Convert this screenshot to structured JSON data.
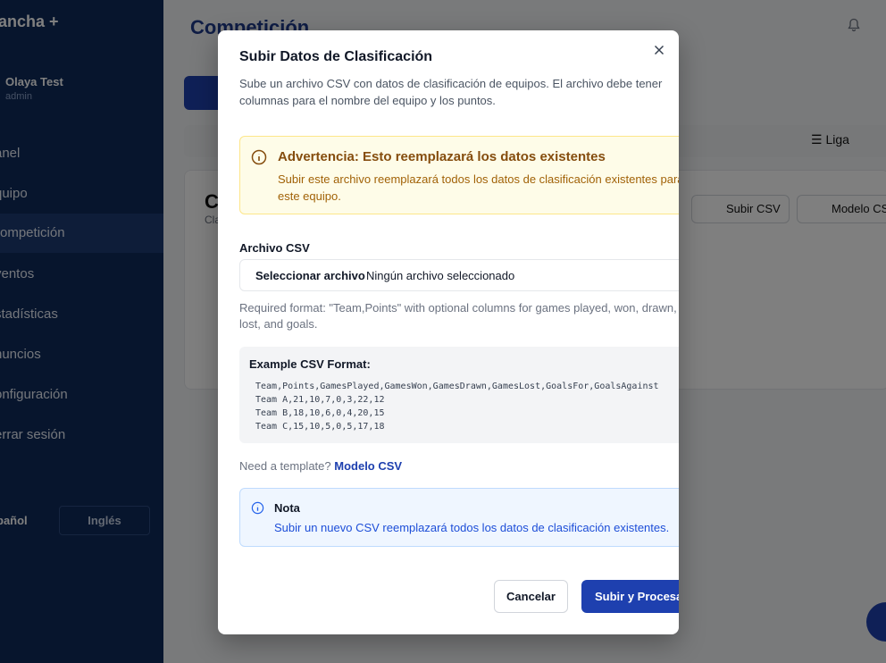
{
  "app": {
    "brand": "ancha +"
  },
  "user": {
    "name": "Olaya Test",
    "role": "admin"
  },
  "sidebar": {
    "items": [
      {
        "label": "anel"
      },
      {
        "label": "quipo"
      },
      {
        "label": "ompetición"
      },
      {
        "label": "ventos"
      },
      {
        "label": "stadísticas"
      },
      {
        "label": "nuncios"
      },
      {
        "label": "onfiguración"
      },
      {
        "label": "errar sesión"
      }
    ],
    "languages": {
      "es": "pañol",
      "en": "Inglés"
    }
  },
  "page": {
    "title": "Competición",
    "tab_liga": "Liga",
    "card_initial": "C",
    "card_sub": "Cla",
    "upload_csv": "Subir CSV",
    "template_csv": "Modelo CS"
  },
  "modal": {
    "title": "Subir Datos de Clasificación",
    "description": "Sube un archivo CSV con datos de clasificación de equipos. El archivo debe tener columnas para el nombre del equipo y los puntos.",
    "warning_title": "Advertencia: Esto reemplazará los datos existentes",
    "warning_text": "Subir este archivo reemplazará todos los datos de clasificación existentes para este equipo.",
    "file_label": "Archivo CSV",
    "file_button": "Seleccionar archivo",
    "file_none": "Ningún archivo seleccionado",
    "format_text": "Required format: \"Team,Points\" with optional columns for games played, won, drawn, lost, and goals.",
    "example_title": "Example CSV Format:",
    "example_lines": [
      "Team,Points,GamesPlayed,GamesWon,GamesDrawn,GamesLost,GoalsFor,GoalsAgainst",
      "Team A,21,10,7,0,3,22,12",
      "Team B,18,10,6,0,4,20,15",
      "Team C,15,10,5,0,5,17,18"
    ],
    "template_prompt": "Need a template?",
    "template_link": "Modelo CSV",
    "note_title": "Nota",
    "note_text": "Subir un nuevo CSV reemplazará todos los datos de clasificación existentes.",
    "cancel": "Cancelar",
    "submit": "Subir y Procesar"
  }
}
